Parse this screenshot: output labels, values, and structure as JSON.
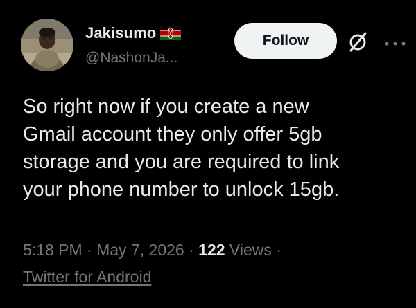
{
  "author": {
    "display_name": "Jakisumo",
    "handle": "@NashonJa...",
    "flag_icon": "kenya-flag-icon"
  },
  "actions": {
    "follow_label": "Follow",
    "grok_icon": "grok-icon",
    "more_icon": "more-horizontal-icon"
  },
  "tweet": {
    "text": "So right now if you create a new\nGmail account they only offer 5gb\nstorage and you are required to link\nyour phone number to unlock 15gb."
  },
  "meta": {
    "time": "5:18 PM",
    "separator": " · ",
    "date": "May 7, 2026",
    "views_count": "122",
    "views_label": " Views",
    "trailing_separator": " ·",
    "source": "Twitter for Android"
  },
  "colors": {
    "background": "#000000",
    "primary_text": "#e7e9ea",
    "secondary_text": "#71767b",
    "follow_bg": "#eff3f4"
  }
}
